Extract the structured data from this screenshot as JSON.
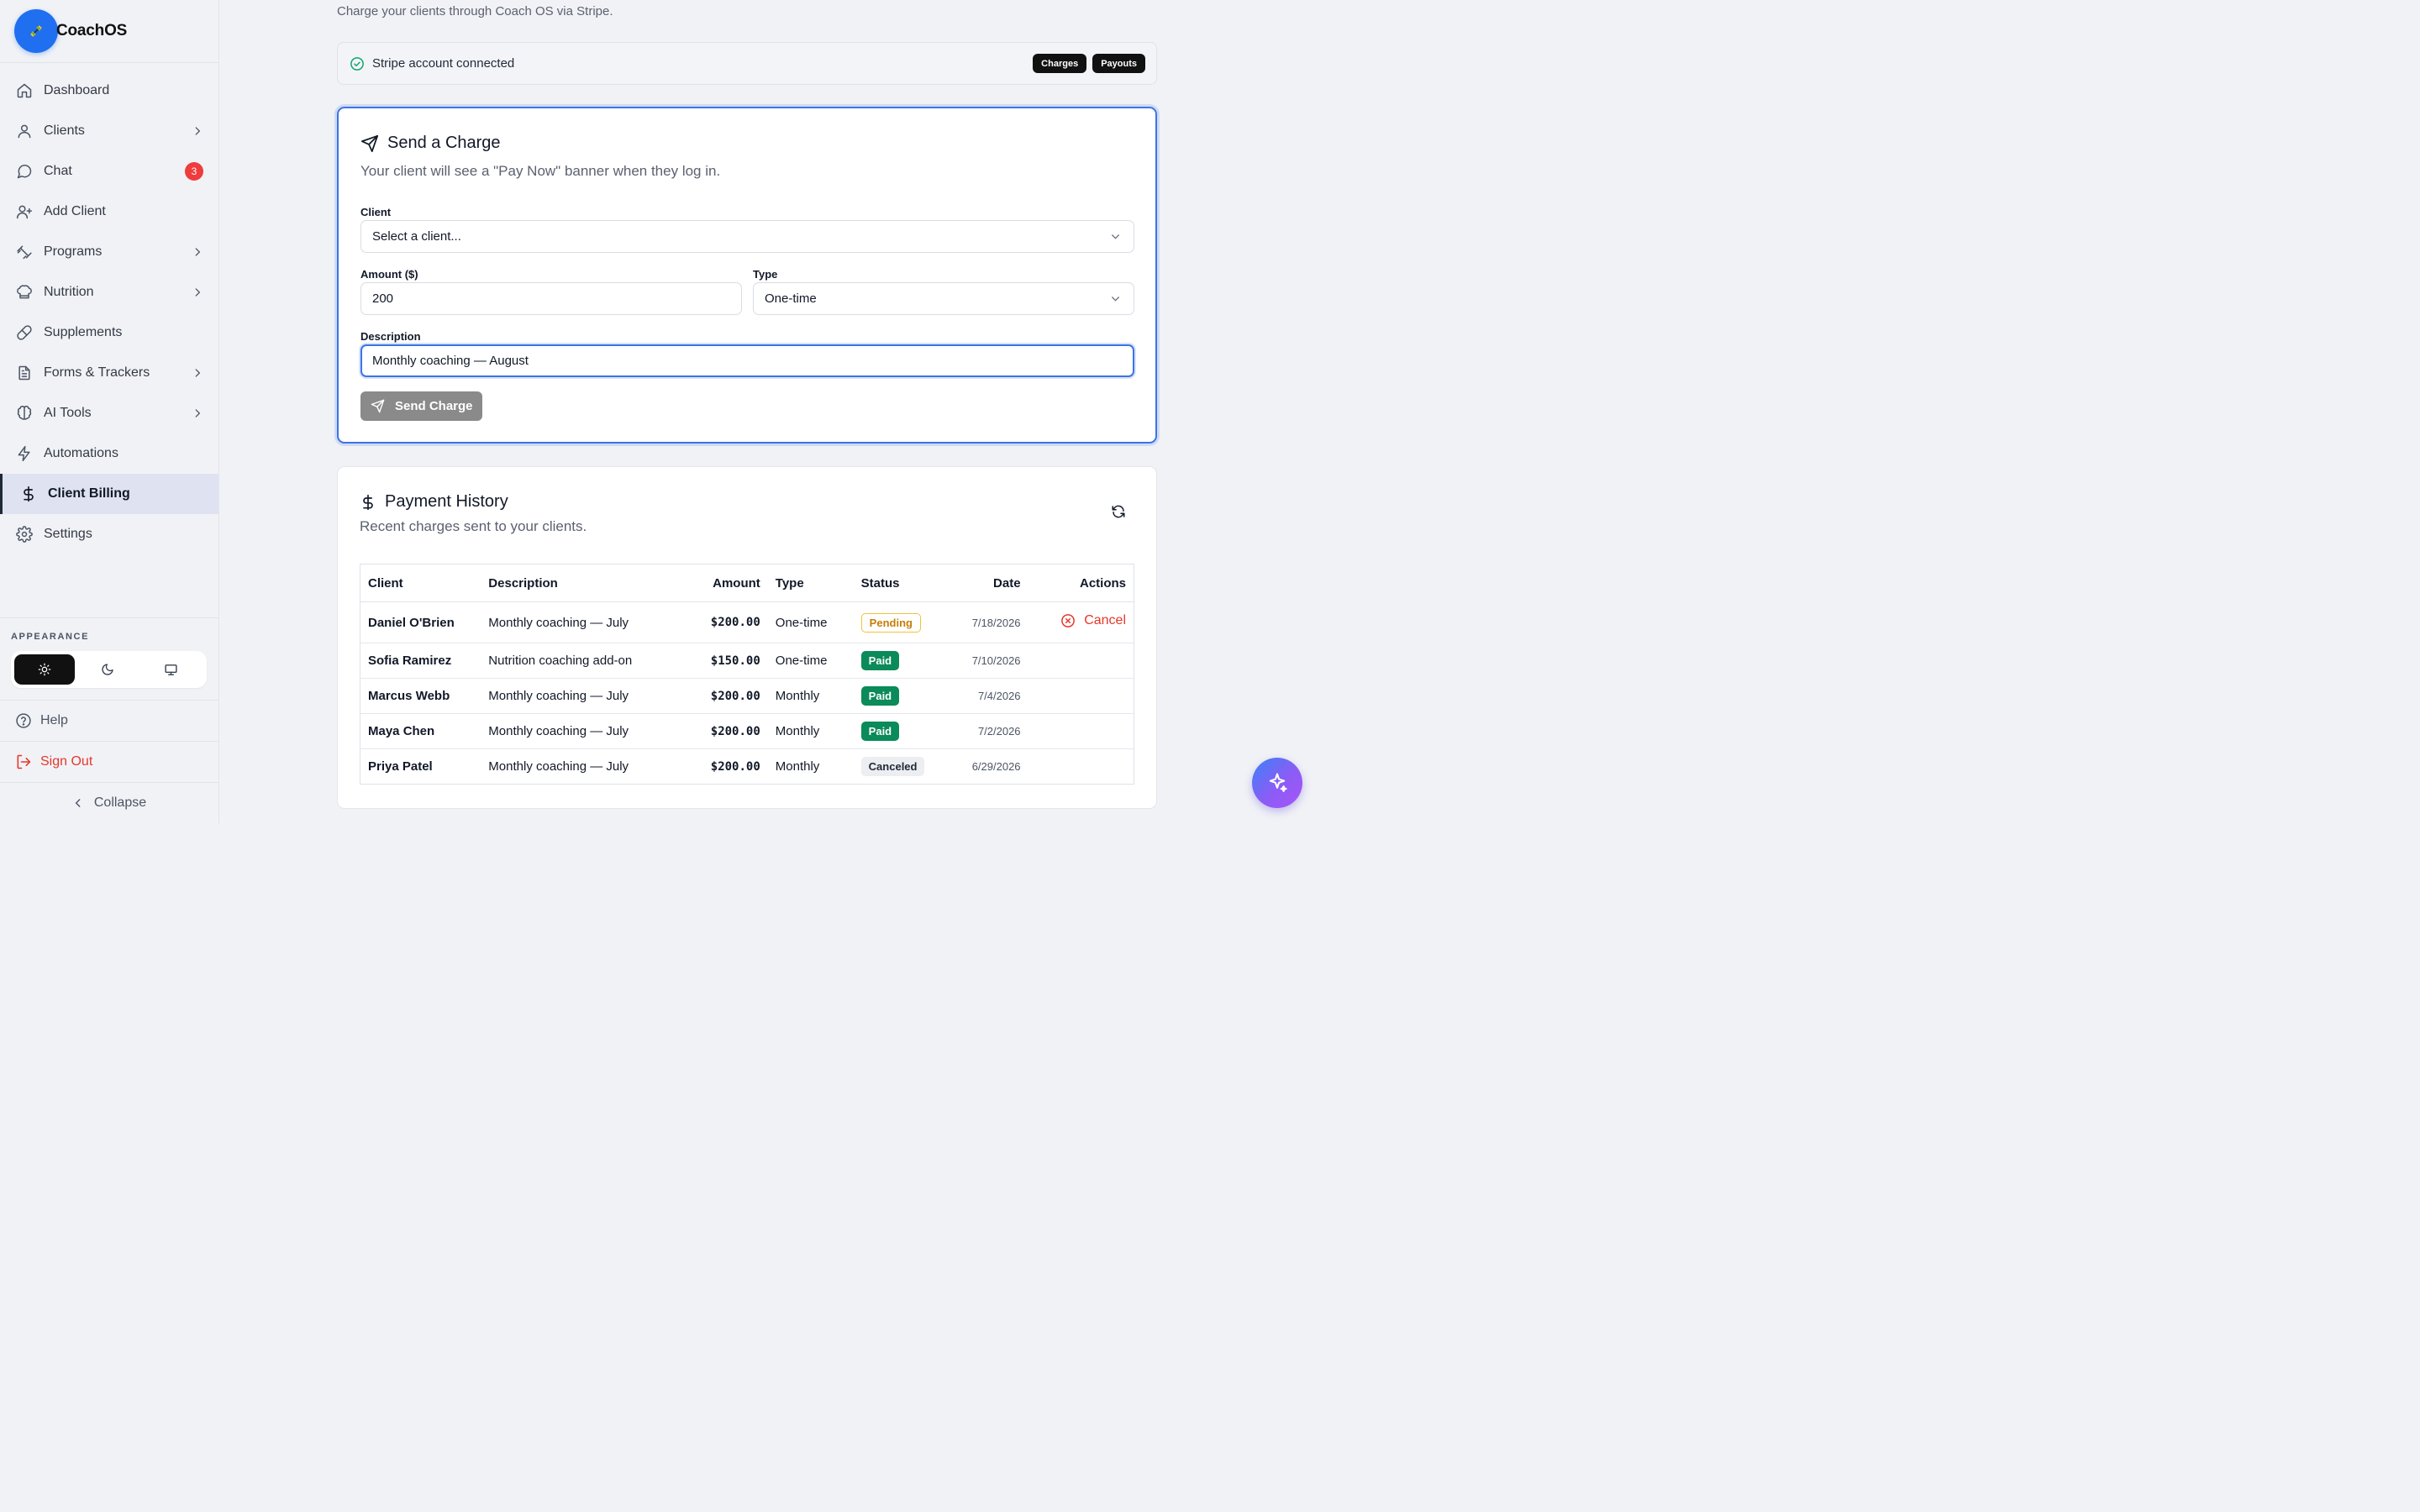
{
  "brand": {
    "name": "CoachOS"
  },
  "sidebar": {
    "items": [
      {
        "label": "Dashboard",
        "icon": "home-icon"
      },
      {
        "label": "Clients",
        "icon": "user-icon",
        "expandable": true
      },
      {
        "label": "Chat",
        "icon": "chat-icon",
        "badge": "3"
      },
      {
        "label": "Add Client",
        "icon": "user-plus-icon"
      },
      {
        "label": "Programs",
        "icon": "dumbbell-icon",
        "expandable": true
      },
      {
        "label": "Nutrition",
        "icon": "chef-hat-icon",
        "expandable": true
      },
      {
        "label": "Supplements",
        "icon": "pill-icon"
      },
      {
        "label": "Forms & Trackers",
        "icon": "document-icon",
        "expandable": true
      },
      {
        "label": "AI Tools",
        "icon": "brain-icon",
        "expandable": true
      },
      {
        "label": "Automations",
        "icon": "bolt-icon"
      },
      {
        "label": "Client Billing",
        "icon": "dollar-icon",
        "active": true
      },
      {
        "label": "Settings",
        "icon": "gear-icon"
      }
    ],
    "appearance_title": "APPEARANCE",
    "theme_selected": "light",
    "help_label": "Help",
    "signout_label": "Sign Out",
    "collapse_label": "Collapse"
  },
  "page": {
    "subtitle": "Charge your clients through Coach OS via Stripe.",
    "stripe_status": "Stripe account connected",
    "pills": [
      "Charges",
      "Payouts"
    ]
  },
  "charge_form": {
    "title": "Send a Charge",
    "description": "Your client will see a \"Pay Now\" banner when they log in.",
    "client_label": "Client",
    "client_value": "Select a client...",
    "amount_label": "Amount ($)",
    "amount_value": "200",
    "type_label": "Type",
    "type_value": "One-time",
    "description_label": "Description",
    "description_value": "Monthly coaching — August",
    "submit_label": "Send Charge"
  },
  "history": {
    "title": "Payment History",
    "description": "Recent charges sent to your clients.",
    "columns": [
      "Client",
      "Description",
      "Amount",
      "Type",
      "Status",
      "Date",
      "Actions"
    ],
    "rows": [
      {
        "client": "Daniel O'Brien",
        "description": "Monthly coaching — July",
        "amount": "$200.00",
        "type": "One-time",
        "status": "Pending",
        "date": "7/18/2026",
        "action": "Cancel"
      },
      {
        "client": "Sofia Ramirez",
        "description": "Nutrition coaching add-on",
        "amount": "$150.00",
        "type": "One-time",
        "status": "Paid",
        "date": "7/10/2026",
        "action": ""
      },
      {
        "client": "Marcus Webb",
        "description": "Monthly coaching — July",
        "amount": "$200.00",
        "type": "Monthly",
        "status": "Paid",
        "date": "7/4/2026",
        "action": ""
      },
      {
        "client": "Maya Chen",
        "description": "Monthly coaching — July",
        "amount": "$200.00",
        "type": "Monthly",
        "status": "Paid",
        "date": "7/2/2026",
        "action": ""
      },
      {
        "client": "Priya Patel",
        "description": "Monthly coaching — July",
        "amount": "$200.00",
        "type": "Monthly",
        "status": "Canceled",
        "date": "6/29/2026",
        "action": ""
      }
    ]
  },
  "colors": {
    "accent": "#3b74e6",
    "brand_blue": "#1f6ff0",
    "danger": "#e5372b",
    "paid": "#0b8a5a",
    "pending": "#f2c23a"
  }
}
